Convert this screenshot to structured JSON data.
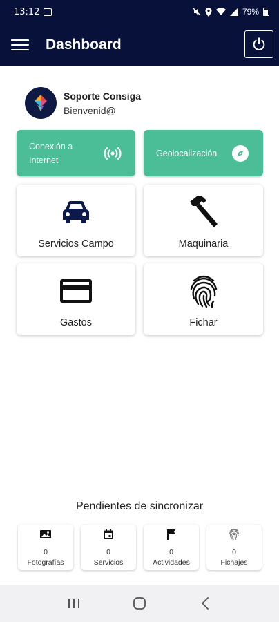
{
  "status_bar": {
    "time": "13:12",
    "battery": "79%"
  },
  "app_bar": {
    "title": "Dashboard"
  },
  "user": {
    "name": "Soporte Consiga",
    "greeting": "Bienvenid@"
  },
  "quick_actions": [
    {
      "label_line1": "Conexión a",
      "label_line2": "Internet",
      "icon": "wifi-signal-icon"
    },
    {
      "label": "Geolocalización",
      "icon": "compass-icon"
    }
  ],
  "menu_cards": [
    {
      "label": "Servicios Campo",
      "icon": "car-icon"
    },
    {
      "label": "Maquinaria",
      "icon": "hammer-icon"
    },
    {
      "label": "Gastos",
      "icon": "credit-card-icon"
    },
    {
      "label": "Fichar",
      "icon": "fingerprint-icon"
    }
  ],
  "pending": {
    "title": "Pendientes de sincronizar",
    "items": [
      {
        "count": "0",
        "label": "Fotografías",
        "icon": "photo-icon"
      },
      {
        "count": "0",
        "label": "Servicios",
        "icon": "calendar-icon"
      },
      {
        "count": "0",
        "label": "Actividades",
        "icon": "flag-icon"
      },
      {
        "count": "0",
        "label": "Fichajes",
        "icon": "fingerprint-icon"
      }
    ]
  },
  "colors": {
    "primary": "#08113a",
    "accent": "#4bbd97"
  }
}
